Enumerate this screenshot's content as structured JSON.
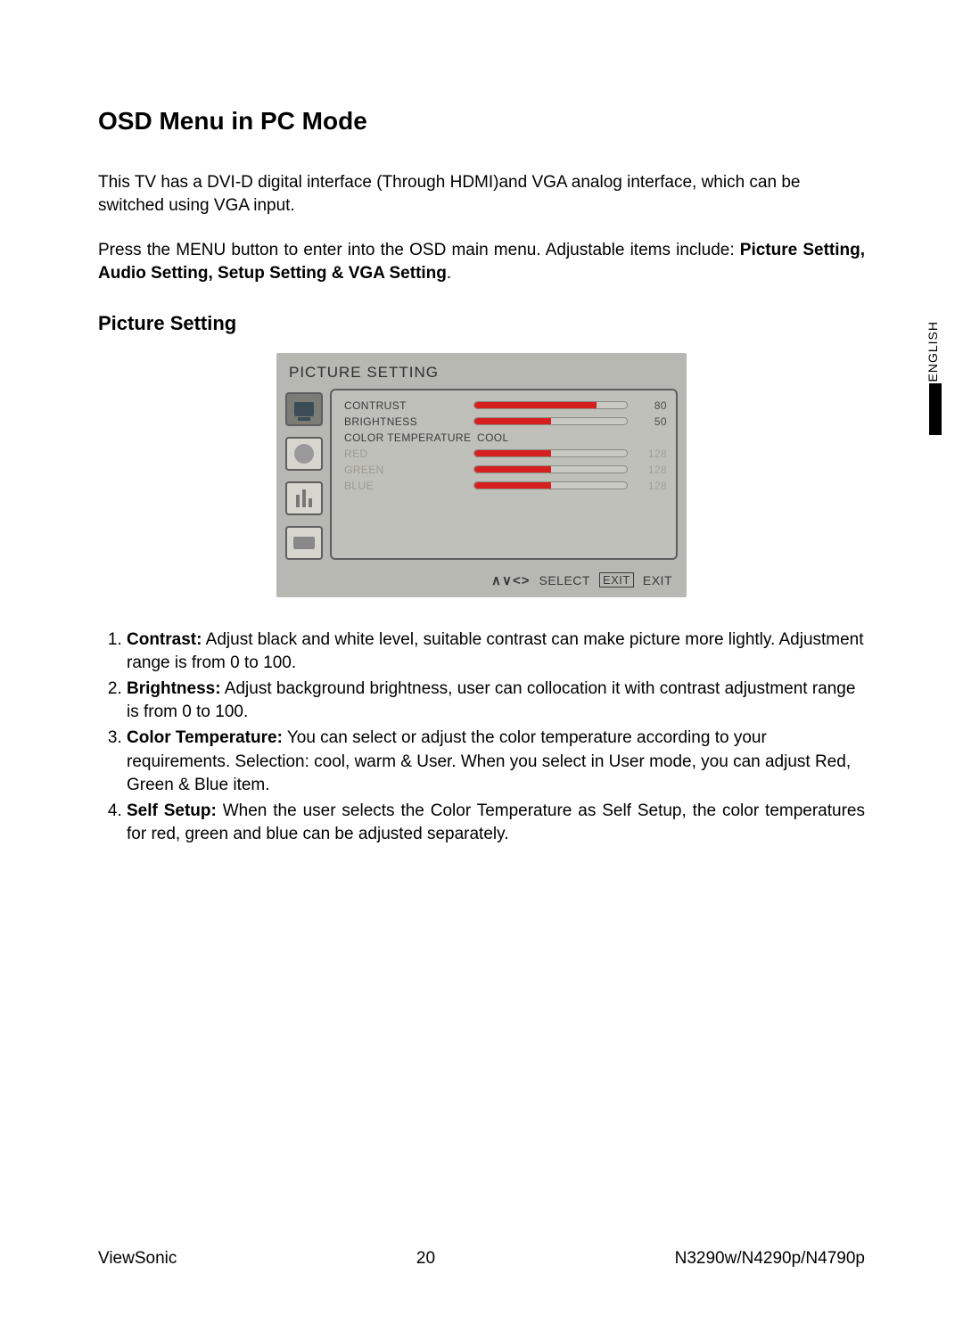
{
  "page": {
    "title": "OSD Menu in PC Mode",
    "intro1": "This TV has a DVI-D digital interface (Through HDMI)and VGA analog interface, which can be switched using VGA input.",
    "intro2_prefix": "Press the MENU button to enter into the OSD main menu. Adjustable items include: ",
    "intro2_bold": "Picture Setting, Audio Setting, Setup Setting & VGA Setting",
    "intro2_suffix": ".",
    "subheading": "Picture Setting",
    "side_label": "ENGLISH"
  },
  "osd": {
    "title": "PICTURE SETTING",
    "footer": {
      "arrows": "∧∨<>",
      "select": "SELECT",
      "exit_box": "EXIT",
      "exit": "EXIT"
    },
    "rows": [
      {
        "label": "CONTRUST",
        "value": 80,
        "fill_pct": 80,
        "dim": false
      },
      {
        "label": "BRIGHTNESS",
        "value": 50,
        "fill_pct": 50,
        "dim": false
      },
      {
        "label": "COLOR TEMPERATURE",
        "text_value": "COOL",
        "dim": false
      },
      {
        "label": "RED",
        "value": 128,
        "fill_pct": 50,
        "dim": true
      },
      {
        "label": "GREEN",
        "value": 128,
        "fill_pct": 50,
        "dim": true
      },
      {
        "label": "BLUE",
        "value": 128,
        "fill_pct": 50,
        "dim": true
      }
    ]
  },
  "list": [
    {
      "bold": "Contrast:",
      "text": " Adjust black and white level, suitable contrast can make picture more lightly. Adjustment range is from 0 to 100."
    },
    {
      "bold": "Brightness:",
      "text": " Adjust background brightness, user can collocation it with contrast adjustment range is from 0 to 100."
    },
    {
      "bold": "Color Temperature:",
      "text": " You can select or adjust the color temperature according to your requirements. Selection: cool, warm & User. When you select in User mode, you can adjust Red, Green & Blue item."
    },
    {
      "bold": "Self Setup:",
      "text": " When the user selects the Color Temperature as Self Setup, the color temperatures for red, green and blue can be adjusted separately.",
      "justify": true
    }
  ],
  "footer": {
    "brand": "ViewSonic",
    "page_num": "20",
    "model": "N3290w/N4290p/N4790p"
  }
}
